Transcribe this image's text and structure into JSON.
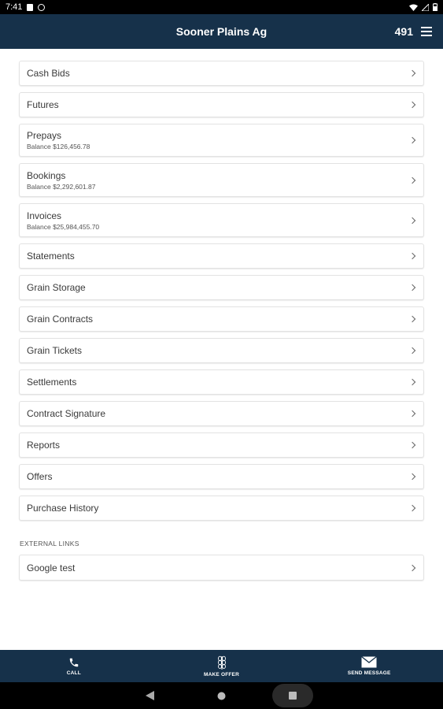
{
  "status_bar": {
    "time": "7:41"
  },
  "header": {
    "title": "Sooner Plains Ag",
    "count": "491"
  },
  "menu": {
    "items": [
      {
        "label": "Cash Bids",
        "sub": ""
      },
      {
        "label": "Futures",
        "sub": ""
      },
      {
        "label": "Prepays",
        "sub": "Balance $126,456.78"
      },
      {
        "label": "Bookings",
        "sub": "Balance $2,292,601.87"
      },
      {
        "label": "Invoices",
        "sub": "Balance $25,984,455.70"
      },
      {
        "label": "Statements",
        "sub": ""
      },
      {
        "label": "Grain Storage",
        "sub": ""
      },
      {
        "label": "Grain Contracts",
        "sub": ""
      },
      {
        "label": "Grain Tickets",
        "sub": ""
      },
      {
        "label": "Settlements",
        "sub": ""
      },
      {
        "label": "Contract Signature",
        "sub": ""
      },
      {
        "label": "Reports",
        "sub": ""
      },
      {
        "label": "Offers",
        "sub": ""
      },
      {
        "label": "Purchase History",
        "sub": ""
      }
    ]
  },
  "external": {
    "section_label": "EXTERNAL LINKS",
    "items": [
      {
        "label": "Google test"
      }
    ]
  },
  "bottom_nav": {
    "call": "CALL",
    "make_offer": "MAKE OFFER",
    "send_message": "SEND MESSAGE"
  },
  "colors": {
    "primary": "#16314a",
    "background": "#ffffff",
    "border": "#e2e2e2"
  },
  "icons": {
    "call": "phone-icon",
    "make_offer": "wheat-icon",
    "send_message": "envelope-icon",
    "menu": "hamburger-icon"
  }
}
